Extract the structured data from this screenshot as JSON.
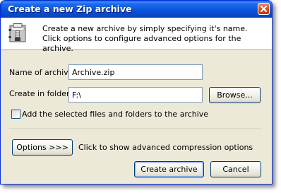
{
  "window": {
    "title": "Create a new Zip archive"
  },
  "header": {
    "description": "Create a new archive by simply specifying it's name. Click options to configure advanced options for the archive."
  },
  "form": {
    "name_label": "Name of archive",
    "name_value": "Archive.zip",
    "folder_label": "Create in folder",
    "folder_value": "F:\\",
    "browse_label": "Browse...",
    "add_selected_label": "Add the selected files and folders to the archive",
    "add_selected_checked": false
  },
  "options": {
    "button_label": "Options >>>",
    "hint": "Click to show advanced compression options"
  },
  "footer": {
    "create_label": "Create archive",
    "cancel_label": "Cancel"
  },
  "colors": {
    "titlebar": "#0b54d8",
    "window_bg": "#ece9d8",
    "close_button": "#d3461a"
  },
  "icons": {
    "header": "zip-archive-icon",
    "close": "close-icon"
  }
}
